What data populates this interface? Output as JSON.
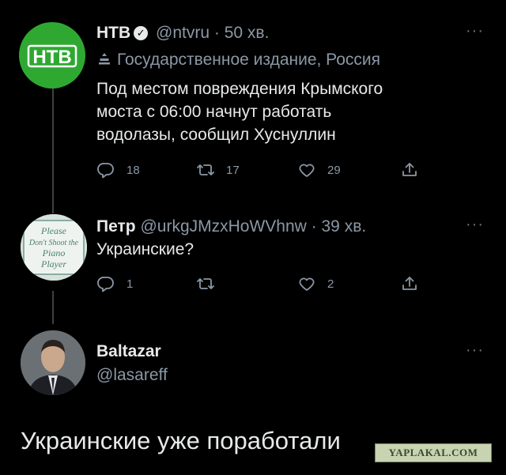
{
  "tweets": [
    {
      "name": "НТВ",
      "verified": true,
      "handle": "@ntvru",
      "separator": "·",
      "time": "50 хв.",
      "label": "Государственное издание, Россия",
      "avatar_text": "НТВ",
      "lines": [
        "Под местом повреждения Крымского",
        "моста с 06:00 начнут работать",
        "водолазы, сообщил Хуснуллин"
      ],
      "replies": "18",
      "retweets": "17",
      "likes": "29"
    },
    {
      "name": "Петр",
      "handle": "@urkgJMzxHoWVhnw",
      "separator": "·",
      "time": "39 хв.",
      "avatar_lines": [
        "Please",
        "Don't Shoot the",
        "Piano",
        "Player"
      ],
      "lines": [
        "Украинские?"
      ],
      "replies": "1",
      "retweets": "",
      "likes": "2"
    },
    {
      "name": "Baltazar",
      "handle": "@lasareff",
      "main_text": "Украинские уже поработали"
    }
  ],
  "more_icon": "···",
  "watermark": "YAPLAKAL.COM",
  "colors": {
    "background": "#000000",
    "text": "#e7e9ea",
    "secondary": "#8b98a5",
    "ntv_green": "#2fa832"
  }
}
